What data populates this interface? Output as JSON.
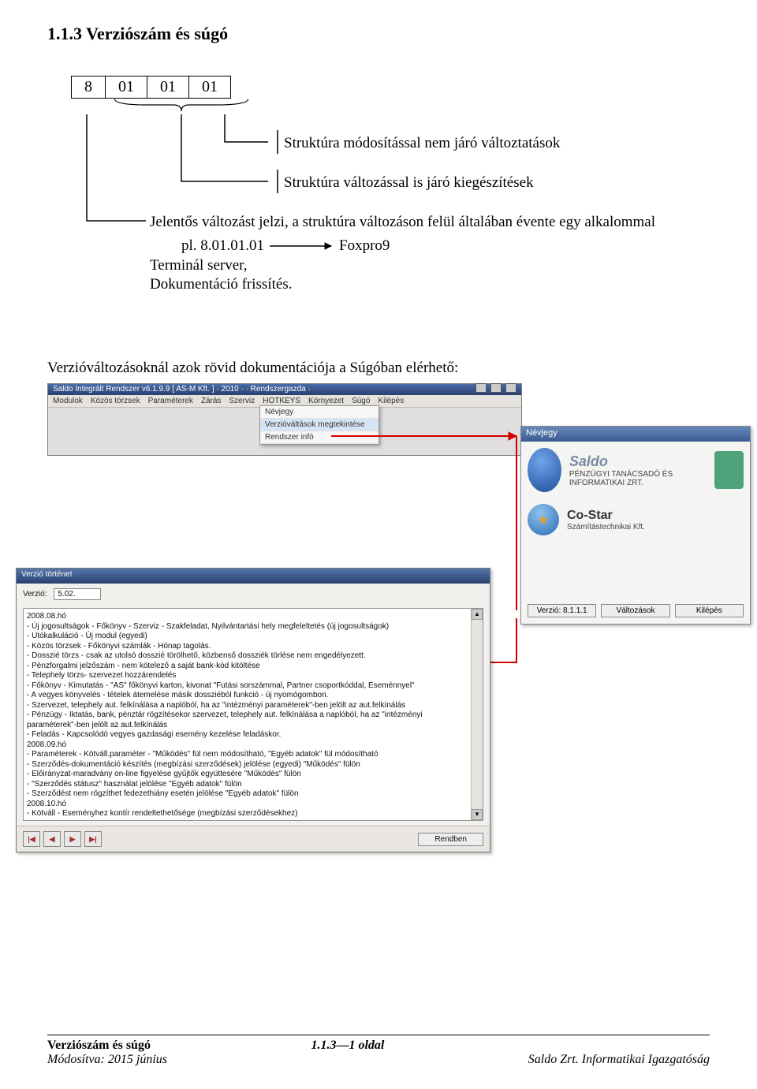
{
  "heading": "1.1.3  Verziószám és súgó",
  "version_cells": [
    "8",
    "01",
    "01",
    "01"
  ],
  "lines": {
    "l1": "Struktúra módosítással nem járó változtatások",
    "l2": "Struktúra változással is járó kiegészítések",
    "l3a": "Jelentős változást jelzi, a struktúra változáson felül általában évente egy alkalommal",
    "l3b": "pl. 8.01.01.01",
    "l3c": "Foxpro9",
    "l3d": "Terminál server,",
    "l3e": "Dokumentáció frissítés."
  },
  "para": "Verzióváltozásoknál    azok    rövid    dokumentációja    a    Súgóban elérhető:",
  "ss1": {
    "title": "Saldo Integrált Rendszer   v6.1.9.9   [ AS-M Kft. ]   · 2010 ·   · Rendszergazda ·",
    "menu": [
      "Modulok",
      "Közös törzsek",
      "Paraméterek",
      "Zárás",
      "Szerviz",
      "HOTKEYS",
      "Környezet",
      "Súgó",
      "Kilépés"
    ],
    "dropdown": [
      "Névjegy",
      "Verzióváltások megtekintése",
      "Rendszer infó"
    ]
  },
  "nevjegy": {
    "title": "Névjegy",
    "company1": "Saldo",
    "company1_sub": "PÉNZÜGYI TANÁCSADÓ ÉS INFORMATIKAI ZRT.",
    "company2": "Co-Star",
    "company2_sub": "Számítástechnikai Kft.",
    "buttons": [
      "Verzió: 8.1.1.1",
      "Változások",
      "Kilépés"
    ]
  },
  "ss2": {
    "title": "Verzió történet",
    "version_label": "Verzió:",
    "version_value": "5.02.",
    "content": [
      "2008.08.hó",
      "- Új jogosultságok - Főkönyv - Szerviz - Szakfeladat, Nyilvántartási hely megfeleltetés (új jogosultságok)",
      "- Utókalkuláció - Új modul (egyedi)",
      "- Közös törzsek - Főkönyvi számlák - Hónap tagolás.",
      "   - Dosszié törzs - csak az utolsó dosszié törölhető, közbenső dossziék törlése nem engedélyezett.",
      "   - Pénzforgalmi jelzőszám - nem kötelező a saját bank-kód kitöltése",
      "   - Telephely törzs- szervezet hozzárendelés",
      "- Főkönyv - Kimutatás - \"AS\" főkönyvi karton, kivonat \"Futási sorszámmal, Partner csoportkóddal, Eseménnyel\"",
      "   - A vegyes könyvelés - tételek átemelése másik dossziéból funkció - új nyomógombon.",
      "   - Szervezet, telephely aut. felkínálása a naplóból, ha az \"intézményi paraméterek\"-ben jelölt az aut.felkínálás",
      "- Pénzügy - Iktatás, bank, pénztár rögzítésekor szervezet, telephely aut. felkínálása a naplóból, ha az \"intézményi paraméterek\"-ben jelölt az aut.felkínálás",
      "- Feladás - Kapcsolódó vegyes gazdasági esemény kezelése feladáskor.",
      "2008.09.hó",
      "- Paraméterek - Kötváll.paraméter - \"Működés\" fül nem módosítható, \"Egyéb adatok\" fül módosítható",
      "   - Szerződés-dokumentáció készítés (megbízási szerződések) jelölése (egyedi) \"Működés\" fülön",
      "   - Előirányzat-maradvány on-line figyelése gyűjtők együttesére \"Működés\" fülön",
      "   - \"Szerződés státusz\" használat jelölése \"Egyéb adatok\" fülön",
      "   - Szerződést nem rögzíthet fedezethiány esetén jelölése \"Egyéb adatok\" fülön",
      "2008.10.hó",
      "- Kötváll - Eseményhez kontír rendeltethetősége (megbízási szerződésekhez)"
    ],
    "ok": "Rendben",
    "nav": [
      "|◀",
      "◀",
      "▶",
      "▶|"
    ]
  },
  "footer": {
    "left_line1": "Verziószám és súgó",
    "left_line2": "Módosítva: 2015 június",
    "center": "1.1.3—1 oldal",
    "right": "Saldo Zrt. Informatikai Igazgatóság"
  }
}
